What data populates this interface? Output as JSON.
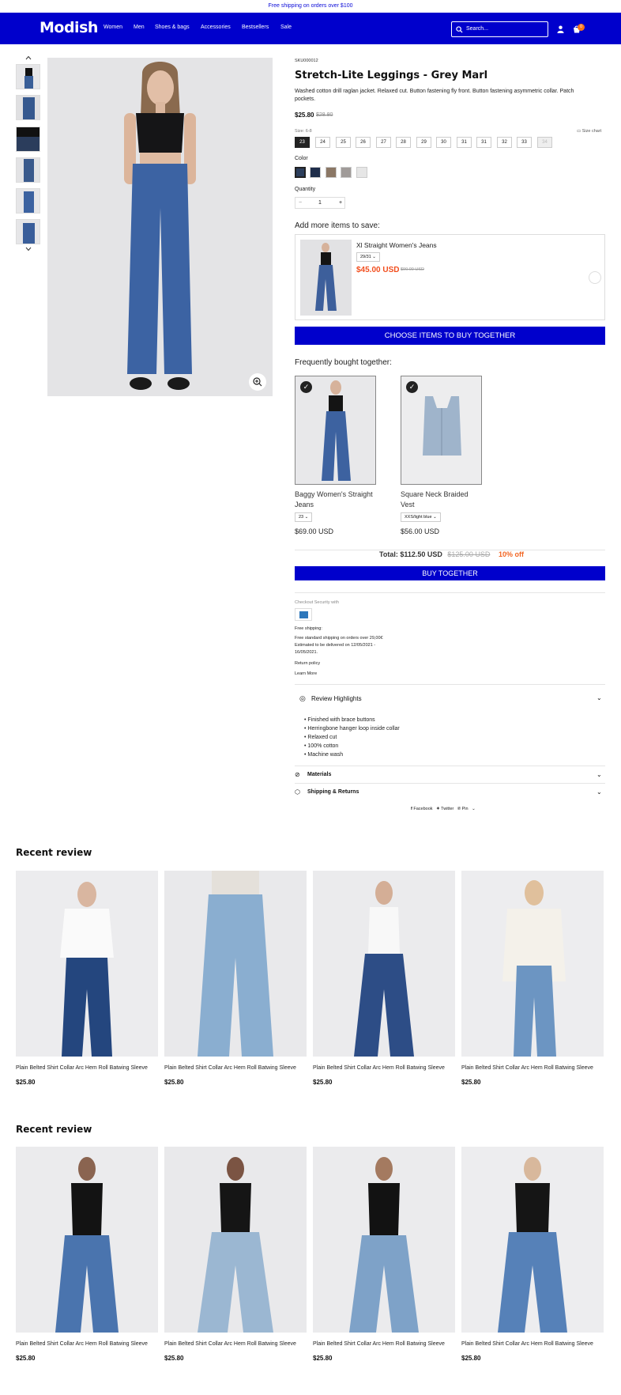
{
  "announcement": "Free shipping on orders over $100",
  "header": {
    "logo": "Modish",
    "nav": [
      "Women",
      "Men",
      "Shoes & bags",
      "Accessories",
      "Bestsellers",
      "Sale"
    ],
    "search_placeholder": "Search...",
    "cart_count": "0",
    "accent": "#0000cc"
  },
  "product": {
    "sku": "SKU000012",
    "title": "Stretch-Lite Leggings - Grey Marl",
    "description": "Washed cotton drill raglan jacket. Relaxed cut. Button fastening fly front. Button fastening asymmetric collar. Patch pockets.",
    "price": "$25.80",
    "old_price": "$28.80",
    "size_label": "Size: 6-8",
    "size_chart": "Size chart",
    "sizes": [
      "23",
      "24",
      "25",
      "26",
      "27",
      "28",
      "29",
      "30",
      "31",
      "31",
      "32",
      "33",
      "34"
    ],
    "selected_size": "23",
    "color_label": "Color",
    "colors": [
      "#2c3e5c",
      "#1e2d4a",
      "#8b7765",
      "#a09b99",
      "#e6e6e6"
    ],
    "quantity_label": "Quantity",
    "quantity": "1",
    "qty_minus": "−",
    "qty_plus": "+"
  },
  "add_more": {
    "heading": "Add more items to save:",
    "item_name": "Xl Straight Women's Jeans",
    "item_size": "29/31",
    "item_price": "$45.00 USD",
    "item_old_price": "$90.00 USD",
    "button": "CHOOSE ITEMS TO BUY TOGETHER"
  },
  "fbt": {
    "heading": "Frequently bought together:",
    "items": [
      {
        "name_line1": "Baggy Women's Straight",
        "name_line2": "Jeans",
        "option": "23",
        "price": "$69.00 USD"
      },
      {
        "name_line1": "Square Neck Braided",
        "name_line2": "Vest",
        "option": "XXS/light blue",
        "price": "$56.00 USD"
      }
    ],
    "total_label": "Total: $112.50 USD",
    "total_old": "$125.00 USD",
    "discount": "10% off",
    "button": "BUY TOGETHER"
  },
  "info": {
    "checkout": "Checkout Security with",
    "free_ship": "Free shipping:",
    "ship_line1": "Free standard shipping on orders over 29,00€",
    "ship_line2": "Estimated to be delivered on 12/05/2021 -",
    "ship_line3": "16/05/2021.",
    "return_policy": "Return policy",
    "learn_more": "Learn More"
  },
  "accordions": {
    "review": "Review Highlights",
    "bullets": [
      "Finished with brace buttons",
      "Herringbone hanger loop inside collar",
      "Relaxed cut",
      "100% cotton",
      "Machine wash"
    ],
    "materials": "Materials",
    "shipping": "Shipping & Returns"
  },
  "share": {
    "facebook": "Facebook",
    "twitter": "Twitter",
    "pin": "Pin"
  },
  "recent1": {
    "heading": "Recent review",
    "items": [
      {
        "name": "Plain Belted Shirt Collar Arc Hem Roll Batwing Sleeve",
        "price": "$25.80"
      },
      {
        "name": "Plain Belted Shirt Collar Arc Hem Roll Batwing Sleeve",
        "price": "$25.80"
      },
      {
        "name": "Plain Belted Shirt Collar Arc Hem Roll Batwing Sleeve",
        "price": "$25.80"
      },
      {
        "name": "Plain Belted Shirt Collar Arc Hem Roll Batwing Sleeve",
        "price": "$25.80"
      }
    ]
  },
  "recent2": {
    "heading": "Recent review",
    "items": [
      {
        "name": "Plain Belted Shirt Collar Arc Hem Roll Batwing Sleeve",
        "price": "$25.80"
      },
      {
        "name": "Plain Belted Shirt Collar Arc Hem Roll Batwing Sleeve",
        "price": "$25.80"
      },
      {
        "name": "Plain Belted Shirt Collar Arc Hem Roll Batwing Sleeve",
        "price": "$25.80"
      },
      {
        "name": "Plain Belted Shirt Collar Arc Hem Roll Batwing Sleeve",
        "price": "$25.80"
      }
    ]
  }
}
